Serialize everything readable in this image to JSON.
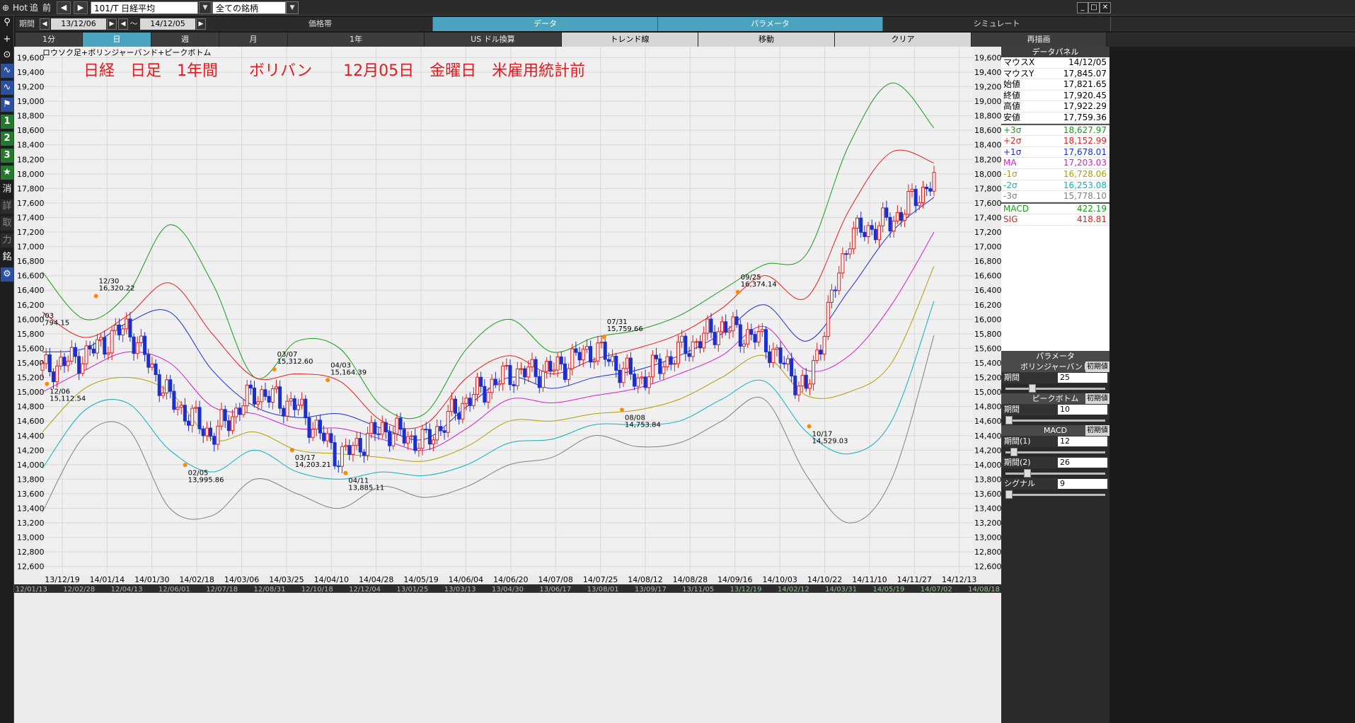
{
  "topbar": {
    "hot": "Hot",
    "follow": "追",
    "prev": "前",
    "symbol": "101/T 日経平均",
    "universe": "全ての銘柄"
  },
  "period": {
    "label": "期間",
    "start": "13/12/06",
    "tilde": "～",
    "end": "14/12/05",
    "price_band": "価格帯",
    "tabs": [
      "データ",
      "パラメータ",
      "シミュレート"
    ]
  },
  "tabs": {
    "items": [
      "1分",
      "日",
      "週",
      "月",
      "1年",
      "US ドル換算",
      "トレンド線",
      "移動",
      "クリア",
      "再描画"
    ],
    "active_index": 1
  },
  "left_toolbar": [
    "⚲",
    "+",
    "⊙",
    "∿",
    "∿",
    "⚑",
    "1",
    "2",
    "3",
    "★",
    "消",
    "詳",
    "取",
    "力",
    "銘",
    "⚙"
  ],
  "chart": {
    "caption": "ロウソク足+ボリンジャーバンド+ピークボトム",
    "annotation": "日経　日足　1年間　　ボリバン　　12月05日　金曜日　米雇用統計前",
    "y_ticks": [
      "19,600",
      "19,400",
      "19,200",
      "19,000",
      "18,800",
      "18,600",
      "18,400",
      "18,200",
      "18,000",
      "17,800",
      "17,600",
      "17,400",
      "17,200",
      "17,000",
      "16,800",
      "16,600",
      "16,400",
      "16,200",
      "16,000",
      "15,800",
      "15,600",
      "15,400",
      "15,200",
      "15,000",
      "14,800",
      "14,600",
      "14,400",
      "14,200",
      "14,000",
      "13,800",
      "13,600",
      "13,400",
      "13,200",
      "13,000",
      "12,800",
      "12,600"
    ],
    "x_ticks": [
      "13/12/19",
      "14/01/14",
      "14/01/30",
      "14/02/18",
      "14/03/06",
      "14/03/25",
      "14/04/10",
      "14/04/28",
      "14/05/19",
      "14/06/04",
      "14/06/20",
      "14/07/08",
      "14/07/25",
      "14/08/12",
      "14/08/28",
      "14/09/16",
      "14/10/03",
      "14/10/22",
      "14/11/10",
      "14/11/27",
      "14/12/13"
    ],
    "timeline_ticks": [
      "12/01/13",
      "12/02/28",
      "12/04/13",
      "12/06/01",
      "12/07/18",
      "12/08/31",
      "12/10/18",
      "12/12/04",
      "13/01/25",
      "13/03/13",
      "13/04/30",
      "13/06/17",
      "13/08/01",
      "13/09/17",
      "13/11/05",
      "13/12/19",
      "14/02/12",
      "14/03/31",
      "14/05/19",
      "14/07/02",
      "14/08/18",
      "14/10/03",
      "14/11/20"
    ],
    "peaks": [
      {
        "date": "12/06",
        "value": "15,112.54"
      },
      {
        "date": "12/30",
        "value": "16,320.22"
      },
      {
        "date": "02/05",
        "value": "13,995.86"
      },
      {
        "date": "03/07",
        "value": "15,312.60"
      },
      {
        "date": "03/17",
        "value": "14,203.21"
      },
      {
        "date": "04/03",
        "value": "15,164.39"
      },
      {
        "date": "04/11",
        "value": "13,885.11"
      },
      {
        "date": "07/31",
        "value": "15,759.66"
      },
      {
        "date": "08/08",
        "value": "14,753.84"
      },
      {
        "date": "09/25",
        "value": "16,374.14"
      },
      {
        "date": "10/17",
        "value": "14,529.03"
      }
    ],
    "left_edge_label": {
      "date": "/03",
      "value": ",794.15"
    }
  },
  "datapanel": {
    "title": "データパネル",
    "rows": [
      {
        "label": "マウスX",
        "value": "14/12/05",
        "color": "#000000"
      },
      {
        "label": "マウスY",
        "value": "17,845.07",
        "color": "#000000"
      },
      {
        "label": "始値",
        "value": "17,821.65",
        "color": "#000000"
      },
      {
        "label": "終値",
        "value": "17,920.45",
        "color": "#000000"
      },
      {
        "label": "高値",
        "value": "17,922.29",
        "color": "#000000"
      },
      {
        "label": "安値",
        "value": "17,759.36",
        "color": "#000000"
      },
      {
        "label": "+3σ",
        "value": "18,627.97",
        "color": "#1a9a1a"
      },
      {
        "label": "+2σ",
        "value": "18,152.99",
        "color": "#e02020"
      },
      {
        "label": "+1σ",
        "value": "17,678.01",
        "color": "#1a2fd0"
      },
      {
        "label": "MA",
        "value": "17,203.03",
        "color": "#d020d0"
      },
      {
        "label": "-1σ",
        "value": "16,728.06",
        "color": "#b0a000"
      },
      {
        "label": "-2σ",
        "value": "16,253.08",
        "color": "#10b0c0"
      },
      {
        "label": "-3σ",
        "value": "15,778.10",
        "color": "#808080"
      },
      {
        "label": "MACD",
        "value": "422.19",
        "color": "#1a9a1a"
      },
      {
        "label": "SIG",
        "value": "418.81",
        "color": "#e02020"
      }
    ]
  },
  "parampanel": {
    "title": "パラメータ",
    "init_label": "初期値",
    "groups": [
      {
        "name": "ボリンジャーバンド",
        "params": [
          {
            "label": "期間",
            "value": "25",
            "level": 0.25
          }
        ]
      },
      {
        "name": "ピークボトム",
        "params": [
          {
            "label": "期間",
            "value": "10",
            "level": 0.0
          }
        ]
      },
      {
        "name": "MACD",
        "params": [
          {
            "label": "期間(1)",
            "value": "12",
            "level": 0.05
          },
          {
            "label": "期間(2)",
            "value": "26",
            "level": 0.2
          },
          {
            "label": "シグナル",
            "value": "9",
            "level": 0.0
          }
        ]
      }
    ]
  },
  "colors": {
    "up": "#e02020",
    "down": "#1a2fd0",
    "plus3": "#1a9a1a",
    "plus2": "#e02020",
    "plus1": "#1a2fd0",
    "ma": "#d020d0",
    "minus1": "#b0a000",
    "minus2": "#10b0c0",
    "minus3": "#808080"
  },
  "chart_data": {
    "type": "line",
    "title": "日経　日足　1年間　　ボリバン　　12月05日　金曜日　米雇用統計前",
    "xlabel": "",
    "ylabel": "",
    "ylim": [
      12500,
      19750
    ],
    "x": [
      "13/12/06",
      "13/12/19",
      "14/01/14",
      "14/01/30",
      "14/02/18",
      "14/03/06",
      "14/03/25",
      "14/04/10",
      "14/04/28",
      "14/05/19",
      "14/06/04",
      "14/06/20",
      "14/07/08",
      "14/07/25",
      "14/08/12",
      "14/08/28",
      "14/09/16",
      "14/10/03",
      "14/10/22",
      "14/11/10",
      "14/11/27",
      "14/12/05"
    ],
    "series": [
      {
        "name": "+3σ",
        "values": [
          16650,
          16000,
          16350,
          17300,
          16500,
          15200,
          15700,
          15600,
          14800,
          14700,
          15600,
          16000,
          15550,
          15750,
          15850,
          16050,
          16400,
          16750,
          16900,
          18400,
          19250,
          18630
        ]
      },
      {
        "name": "+2σ",
        "values": [
          16100,
          15750,
          16050,
          16500,
          15800,
          15200,
          15250,
          15150,
          14600,
          14550,
          15200,
          15500,
          15250,
          15450,
          15600,
          15800,
          16150,
          16600,
          16300,
          17500,
          18300,
          18150
        ]
      },
      {
        "name": "+1σ",
        "values": [
          15550,
          15600,
          15950,
          16100,
          15300,
          14800,
          14650,
          14700,
          14500,
          14350,
          14800,
          15200,
          15050,
          15200,
          15300,
          15500,
          15800,
          16200,
          15700,
          16400,
          17200,
          17680
        ]
      },
      {
        "name": "MA",
        "values": [
          15000,
          15300,
          15550,
          15400,
          14800,
          14700,
          14500,
          14500,
          14350,
          14200,
          14500,
          14900,
          14850,
          14950,
          15050,
          15250,
          15500,
          15900,
          15300,
          15500,
          16200,
          17200
        ]
      },
      {
        "name": "-1σ",
        "values": [
          14450,
          15050,
          15200,
          15000,
          14350,
          14450,
          14200,
          14150,
          14100,
          14050,
          14250,
          14600,
          14600,
          14700,
          14750,
          14900,
          15200,
          15500,
          14950,
          15000,
          15400,
          16730
        ]
      },
      {
        "name": "-2σ",
        "values": [
          13950,
          14750,
          14850,
          14200,
          13900,
          14200,
          13900,
          13800,
          13900,
          13850,
          14000,
          14300,
          14350,
          14550,
          14550,
          14600,
          14900,
          15150,
          14450,
          14150,
          14600,
          16250
        ]
      },
      {
        "name": "-3σ",
        "values": [
          13350,
          14400,
          14500,
          13400,
          13300,
          13800,
          13600,
          13400,
          13700,
          13550,
          13700,
          14000,
          14100,
          14400,
          14250,
          14300,
          14600,
          14900,
          13850,
          13200,
          13800,
          15780
        ]
      },
      {
        "name": "Close",
        "values": [
          15300,
          15500,
          15900,
          14900,
          14400,
          15000,
          14800,
          14100,
          14500,
          14300,
          14900,
          15250,
          15300,
          15600,
          15150,
          15550,
          15900,
          15700,
          15000,
          17150,
          17350,
          17920
        ]
      }
    ]
  }
}
